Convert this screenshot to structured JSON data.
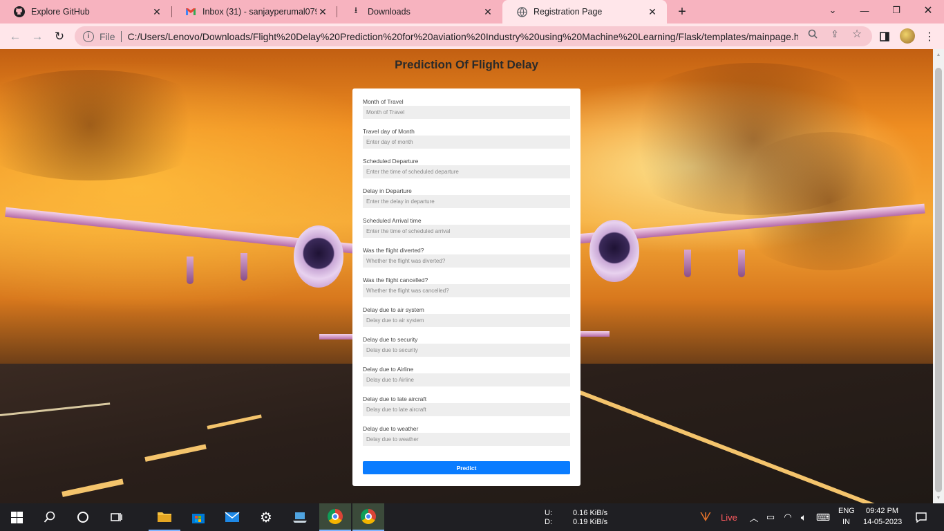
{
  "browser": {
    "tabs": [
      {
        "title": "Explore GitHub",
        "icon": "github-icon",
        "active": false
      },
      {
        "title": "Inbox (31) - sanjayperumal079@",
        "icon": "gmail-icon",
        "active": false
      },
      {
        "title": "Downloads",
        "icon": "download-icon",
        "active": false
      },
      {
        "title": "Registration Page",
        "icon": "globe-icon",
        "active": true
      }
    ],
    "address_bar": {
      "scheme_label": "File",
      "url": "C:/Users/Lenovo/Downloads/Flight%20Delay%20Prediction%20for%20aviation%20Industry%20using%20Machine%20Learning/Flask/templates/mainpage.ht..."
    }
  },
  "page": {
    "heading": "Prediction Of Flight Delay",
    "form": {
      "fields": [
        {
          "label": "Month of Travel",
          "placeholder": "Month of Travel"
        },
        {
          "label": "Travel day of Month",
          "placeholder": "Enter day of month"
        },
        {
          "label": "Scheduled Departure",
          "placeholder": "Enter the time of scheduled departure"
        },
        {
          "label": "Delay in Departure",
          "placeholder": "Enter the delay in departure"
        },
        {
          "label": "Scheduled Arrival time",
          "placeholder": "Enter the time of scheduled arrival"
        },
        {
          "label": "Was the flight diverted?",
          "placeholder": "Whether the flight was diverted?"
        },
        {
          "label": "Was the flight cancelled?",
          "placeholder": "Whether the flight was cancelled?"
        },
        {
          "label": "Delay due to air system",
          "placeholder": "Delay due to air system"
        },
        {
          "label": "Delay due to security",
          "placeholder": "Delay due to security"
        },
        {
          "label": "Delay due to Airline",
          "placeholder": "Delay due to Airline"
        },
        {
          "label": "Delay due to late aircraft",
          "placeholder": "Delay due to late aircraft"
        },
        {
          "label": "Delay due to weather",
          "placeholder": "Delay due to weather"
        }
      ],
      "submit_label": "Predict",
      "submit_color": "#0a7cff"
    }
  },
  "taskbar": {
    "network_upload_label": "U:",
    "network_upload": "0.16 KiB/s",
    "network_download_label": "D:",
    "network_download": "0.19 KiB/s",
    "live_label": "Live",
    "language": "ENG",
    "region": "IN",
    "time": "09:42 PM",
    "date": "14-05-2023"
  }
}
